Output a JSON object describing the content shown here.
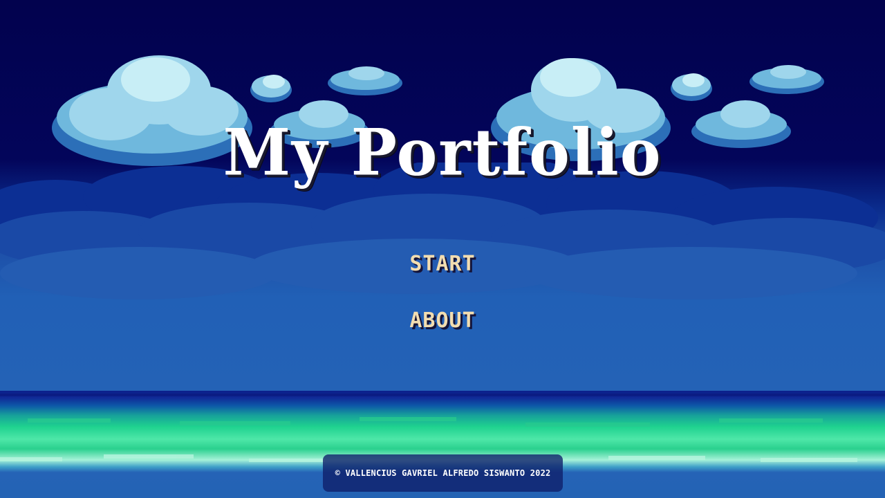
{
  "title": "My Portfolio",
  "menu": {
    "start_label": "START",
    "about_label": "ABOUT"
  },
  "footer": {
    "copyright_symbol": "©",
    "credit": "VALLENCIUS GAVRIEL ALFREDO SISWANTO 2022"
  },
  "colors": {
    "sky_top": "#02024e",
    "sky_mid": "#2160b6",
    "cloud_light": "#c8eef6",
    "cloud_mid": "#6fb8dd",
    "cloud_shadow": "#2c6fb8",
    "sea_green": "#1fd28f",
    "menu_text": "#f2ddb0",
    "title_text": "#ffffff"
  }
}
